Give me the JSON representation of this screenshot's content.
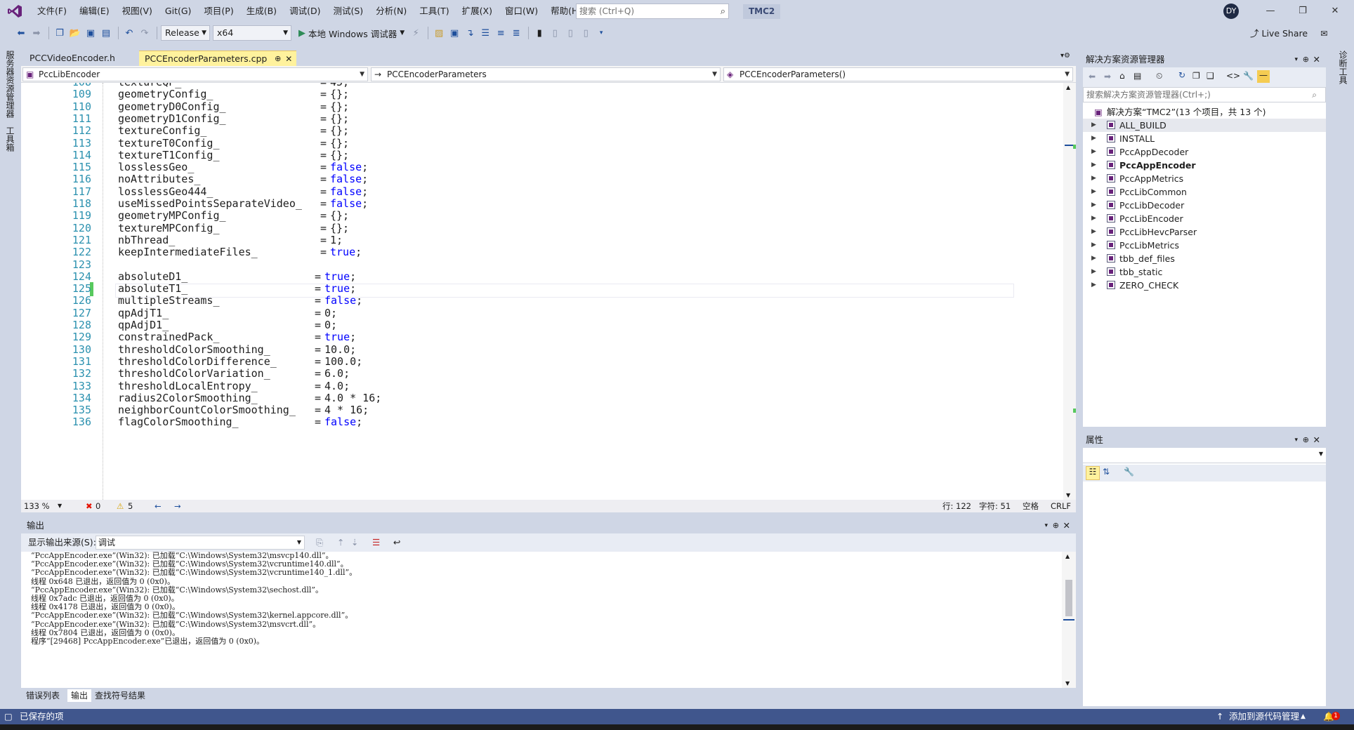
{
  "menu": [
    "文件(F)",
    "编辑(E)",
    "视图(V)",
    "Git(G)",
    "项目(P)",
    "生成(B)",
    "调试(D)",
    "测试(S)",
    "分析(N)",
    "工具(T)",
    "扩展(X)",
    "窗口(W)",
    "帮助(H)"
  ],
  "search": {
    "placeholder": "搜索 (Ctrl+Q)"
  },
  "solution_name": "TMC2",
  "user_initials": "DY",
  "toolbar": {
    "config": "Release",
    "platform": "x64",
    "run_label": "本地 Windows 调试器",
    "live_share": "Live Share"
  },
  "left_strip": {
    "server_explorer": "服务器资源管理器",
    "toolbox": "工具箱"
  },
  "right_strip": {
    "diagnostics": "诊断工具"
  },
  "tabs": [
    {
      "label": "PCCVideoEncoder.h"
    },
    {
      "label": "PCCEncoderParameters.cpp"
    }
  ],
  "nav": {
    "project": "PccLibEncoder",
    "scope": "PCCEncoderParameters",
    "member": "PCCEncoderParameters()"
  },
  "code": [
    {
      "num": "108",
      "name": "textureQP_",
      "val": "45;",
      "kw": false
    },
    {
      "num": "109",
      "name": "geometryConfig_",
      "val": "{};",
      "kw": false
    },
    {
      "num": "110",
      "name": "geometryD0Config_",
      "val": "{};",
      "kw": false
    },
    {
      "num": "111",
      "name": "geometryD1Config_",
      "val": "{};",
      "kw": false
    },
    {
      "num": "112",
      "name": "textureConfig_",
      "val": "{};",
      "kw": false
    },
    {
      "num": "113",
      "name": "textureT0Config_",
      "val": "{};",
      "kw": false
    },
    {
      "num": "114",
      "name": "textureT1Config_",
      "val": "{};",
      "kw": false
    },
    {
      "num": "115",
      "name": "losslessGeo_",
      "val": "false",
      "kw": true
    },
    {
      "num": "116",
      "name": "noAttributes_",
      "val": "false",
      "kw": true
    },
    {
      "num": "117",
      "name": "losslessGeo444_",
      "val": "false",
      "kw": true
    },
    {
      "num": "118",
      "name": "useMissedPointsSeparateVideo_",
      "val": "false",
      "kw": true
    },
    {
      "num": "119",
      "name": "geometryMPConfig_",
      "val": "{};",
      "kw": false
    },
    {
      "num": "120",
      "name": "textureMPConfig_",
      "val": "{};",
      "kw": false
    },
    {
      "num": "121",
      "name": "nbThread_",
      "val": "1;",
      "kw": false
    },
    {
      "num": "122",
      "name": "keepIntermediateFiles_",
      "val": "true",
      "kw": true
    },
    {
      "num": "123",
      "name": "",
      "val": "",
      "kw": false
    },
    {
      "num": "124",
      "name": "absoluteD1_",
      "val": "true",
      "kw": true
    },
    {
      "num": "125",
      "name": "absoluteT1_",
      "val": "true",
      "kw": true
    },
    {
      "num": "126",
      "name": "multipleStreams_",
      "val": "false",
      "kw": true
    },
    {
      "num": "127",
      "name": "qpAdjT1_",
      "val": "0;",
      "kw": false
    },
    {
      "num": "128",
      "name": "qpAdjD1_",
      "val": "0;",
      "kw": false
    },
    {
      "num": "129",
      "name": "constrainedPack_",
      "val": "true",
      "kw": true
    },
    {
      "num": "130",
      "name": "thresholdColorSmoothing_",
      "val": "10.0;",
      "kw": false
    },
    {
      "num": "131",
      "name": "thresholdColorDifference_",
      "val": "100.0;",
      "kw": false
    },
    {
      "num": "132",
      "name": "thresholdColorVariation_",
      "val": "6.0;",
      "kw": false
    },
    {
      "num": "133",
      "name": "thresholdLocalEntropy_",
      "val": "4.0;",
      "kw": false
    },
    {
      "num": "134",
      "name": "radius2ColorSmoothing_",
      "val": "4.0 * 16;",
      "kw": false
    },
    {
      "num": "135",
      "name": "neighborCountColorSmoothing_",
      "val": "4 * 16;",
      "kw": false
    },
    {
      "num": "136",
      "name": "flagColorSmoothing_",
      "val": "false",
      "kw": true
    }
  ],
  "editor_status": {
    "zoom": "133 %",
    "errors": "0",
    "warnings": "5",
    "line": "行: 122",
    "col": "字符: 51",
    "indent": "空格",
    "eol": "CRLF"
  },
  "output": {
    "title": "输出",
    "source_label": "显示输出来源(S):",
    "source_value": "调试",
    "lines": [
      "“PccAppEncoder.exe”(Win32): 已加载“C:\\Windows\\System32\\msvcp140.dll”。",
      "“PccAppEncoder.exe”(Win32): 已加载“C:\\Windows\\System32\\vcruntime140.dll”。",
      "“PccAppEncoder.exe”(Win32): 已加载“C:\\Windows\\System32\\vcruntime140_1.dll”。",
      "线程 0x648 已退出，返回值为 0 (0x0)。",
      "“PccAppEncoder.exe”(Win32): 已加载“C:\\Windows\\System32\\sechost.dll”。",
      "线程 0x7adc 已退出，返回值为 0 (0x0)。",
      "线程 0x4178 已退出，返回值为 0 (0x0)。",
      "“PccAppEncoder.exe”(Win32): 已加载“C:\\Windows\\System32\\kernel.appcore.dll”。",
      "“PccAppEncoder.exe”(Win32): 已加载“C:\\Windows\\System32\\msvcrt.dll”。",
      "线程 0x7804 已退出，返回值为 0 (0x0)。",
      "程序“[29468] PccAppEncoder.exe”已退出，返回值为 0 (0x0)。"
    ]
  },
  "bottom_tabs": [
    "错误列表",
    "输出",
    "查找符号结果"
  ],
  "solution_explorer": {
    "title": "解决方案资源管理器",
    "search_placeholder": "搜索解决方案资源管理器(Ctrl+;)",
    "root": "解决方案“TMC2”(13 个项目，共 13 个)",
    "projects": [
      "ALL_BUILD",
      "INSTALL",
      "PccAppDecoder",
      "PccAppEncoder",
      "PccAppMetrics",
      "PccLibCommon",
      "PccLibDecoder",
      "PccLibEncoder",
      "PccLibHevcParser",
      "PccLibMetrics",
      "tbb_def_files",
      "tbb_static",
      "ZERO_CHECK"
    ],
    "startup_project": "PccAppEncoder"
  },
  "properties": {
    "title": "属性"
  },
  "statusbar": {
    "left": "已保存的项",
    "right": "添加到源代码管理",
    "notifications": "1"
  }
}
